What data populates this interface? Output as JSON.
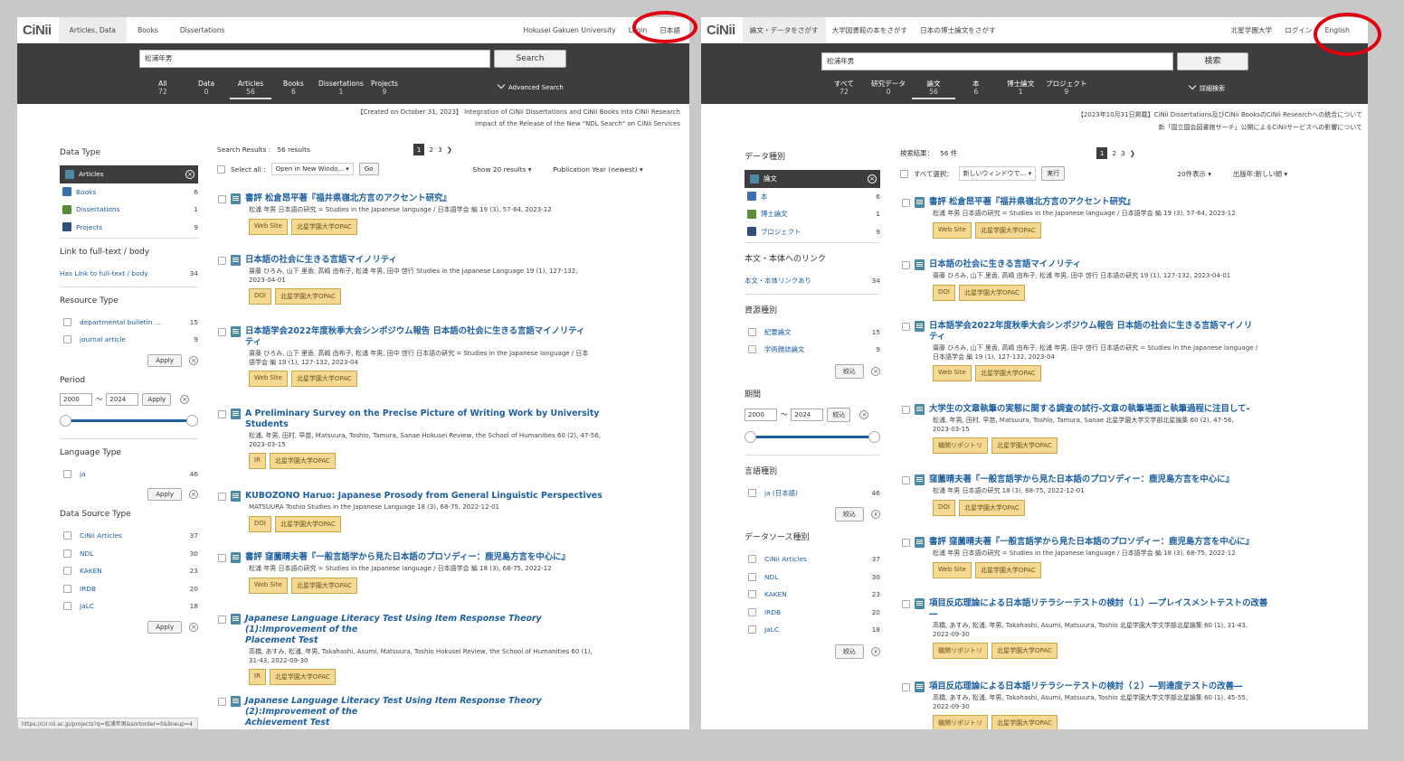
{
  "en": {
    "logo": "CiNii",
    "nav": [
      "Articles, Data",
      "Books",
      "Dissertations"
    ],
    "univ": "Hokusei Gakuen University",
    "login": "Login",
    "lang": "日本語",
    "query": "松浦年男",
    "search_btn": "Search",
    "tabs": [
      {
        "l": "All",
        "n": "72"
      },
      {
        "l": "Data",
        "n": "0"
      },
      {
        "l": "Articles",
        "n": "56"
      },
      {
        "l": "Books",
        "n": "6"
      },
      {
        "l": "Dissertations",
        "n": "1"
      },
      {
        "l": "Projects",
        "n": "9"
      }
    ],
    "adv": "Advanced Search",
    "ann1": "【Created on October 31, 2023】 Integration of CiNii Dissertations and CiNii Books into CiNii Research",
    "ann2": "Impact of the Release of the New \"NDL Search\" on CiNii Services",
    "f_datatype": "Data Type",
    "types": [
      {
        "l": "Articles",
        "c": ""
      },
      {
        "l": "Books",
        "c": "6"
      },
      {
        "l": "Dissertations",
        "c": "1"
      },
      {
        "l": "Projects",
        "c": "9"
      }
    ],
    "f_link": "Link to full-text / body",
    "link_item": "Has Link to full-text / body",
    "link_count": "34",
    "f_resource": "Resource Type",
    "resources": [
      {
        "l": "departmental bulletin ...",
        "c": "15"
      },
      {
        "l": "journal article",
        "c": "9"
      }
    ],
    "apply": "Apply",
    "f_period": "Period",
    "from": "2000",
    "to": "2024",
    "tilde": "〜",
    "f_lang": "Language Type",
    "langs": [
      {
        "l": "ja",
        "c": "46"
      }
    ],
    "f_source": "Data Source Type",
    "sources": [
      {
        "l": "CiNii Articles",
        "c": "37"
      },
      {
        "l": "NDL",
        "c": "30"
      },
      {
        "l": "KAKEN",
        "c": "23"
      },
      {
        "l": "IRDB",
        "c": "20"
      },
      {
        "l": "JaLC",
        "c": "18"
      }
    ],
    "results_label": "Search Results :",
    "results_count": "56 results",
    "pages": [
      "1",
      "2",
      "3"
    ],
    "selectall": "Select all :",
    "open": "Open in New Windo...",
    "go": "Go",
    "show": "Show 20 results",
    "sort": "Publication Year (newest)",
    "results": [
      {
        "t": "書評 松倉昂平著『福井県嶺北方言のアクセント研究』",
        "m": [
          "松浦 年男 日本語の研究 = Studies in the Japanese language / 日本語学会 編 19 (3), 57-64, 2023-12"
        ],
        "b": [
          "Web Site",
          "北星学園大学OPAC"
        ]
      },
      {
        "t": "日本語の社会に生きる言語マイノリティ",
        "m": [
          "齋藤 ひろみ, 山下 里香, 高嶋 由布子, 松浦 年男, 田中 啓行 Studies in the Japanese Language 19 (1), 127-132,",
          "2023-04-01"
        ],
        "b": [
          "DOI",
          "北星学園大学OPAC"
        ]
      },
      {
        "t": "日本語学会2022年度秋季大会シンポジウム報告 日本語の社会に生きる言語マイノリティ",
        "t2": "ティ",
        "m": [
          "齋藤 ひろみ, 山下 里香, 高嶋 由布子, 松浦 年男, 田中 啓行 日本語の研究 = Studies in the Japanese language / 日本",
          "語学会 編 19 (1), 127-132, 2023-04"
        ],
        "b": [
          "Web Site",
          "北星学園大学OPAC"
        ]
      },
      {
        "t": "A Preliminary Survey on the Precise Picture of Writing Work by University",
        "t2": "Students",
        "m": [
          "松浦, 年男, 田村, 早苗, Matsuura, Toshio, Tamura, Sanae Hokusei Review, the School of Humanities 60 (2), 47-56,",
          "2023-03-15"
        ],
        "b": [
          "IR",
          "北星学園大学OPAC"
        ]
      },
      {
        "t": "KUBOZONO Haruo: Japanese Prosody from General Linguistic Perspectives",
        "m": [
          "MATSUURA Toshio Studies in the Japanese Language 18 (3), 68-75, 2022-12-01"
        ],
        "b": [
          "DOI",
          "北星学園大学OPAC"
        ]
      },
      {
        "t": "書評 窪薗晴夫著『一般言語学から見た日本語のプロソディー：鹿児島方言を中心に』",
        "m": [
          "松浦 年男 日本語の研究 = Studies in the Japanese language / 日本語学会 編 18 (3), 68-75, 2022-12"
        ],
        "b": [
          "Web Site",
          "北星学園大学OPAC"
        ]
      },
      {
        "t": "Japanese Language Literacy Test Using Item Response Theory (1):Improvement of the",
        "t2": "Placement Test",
        "it": true,
        "m": [
          "高橋, あすみ, 松浦, 年男, Takahashi, Asumi, Matsuura, Toshio Hokusei Review, the School of Humanities 60 (1),",
          "31-43, 2022-09-30"
        ],
        "b": [
          "IR",
          "北星学園大学OPAC"
        ]
      },
      {
        "t": "Japanese Language Literacy Test Using Item Response Theory (2):Improvement of the",
        "t2": "Achievement Test",
        "it": true,
        "m": [],
        "b": []
      }
    ],
    "url": "https://cir.nii.ac.jp/projects?q=松浦年男&sortorder=0&lineup=4"
  },
  "ja": {
    "logo": "CiNii",
    "nav": [
      "論文・データをさがす",
      "大学図書館の本をさがす",
      "日本の博士論文をさがす"
    ],
    "univ": "北星学園大学",
    "login": "ログイン",
    "lang": "English",
    "query": "松浦年男",
    "search_btn": "検索",
    "tabs": [
      {
        "l": "すべて",
        "n": "72"
      },
      {
        "l": "研究データ",
        "n": "0"
      },
      {
        "l": "論文",
        "n": "56"
      },
      {
        "l": "本",
        "n": "6"
      },
      {
        "l": "博士論文",
        "n": "1"
      },
      {
        "l": "プロジェクト",
        "n": "9"
      }
    ],
    "adv": "詳細検索",
    "ann1": "【2023年10月31日掲載】CiNii Dissertations及びCiNii BooksのCiNii Researchへの統合について",
    "ann2": "新「国立国会図書館サーチ」公開によるCiNiiサービスへの影響について",
    "f_datatype": "データ種別",
    "types": [
      {
        "l": "論文",
        "c": ""
      },
      {
        "l": "本",
        "c": "6"
      },
      {
        "l": "博士論文",
        "c": "1"
      },
      {
        "l": "プロジェクト",
        "c": "9"
      }
    ],
    "f_link": "本文・本体へのリンク",
    "link_item": "本文・本体リンクあり",
    "link_count": "34",
    "f_resource": "資源種別",
    "resources": [
      {
        "l": "紀要論文",
        "c": "15"
      },
      {
        "l": "学術雑誌論文",
        "c": "9"
      }
    ],
    "apply": "絞込",
    "f_period": "期間",
    "from": "2000",
    "to": "2024",
    "tilde": "〜",
    "f_lang": "言語種別",
    "langs": [
      {
        "l": "ja (日本語)",
        "c": "46"
      }
    ],
    "f_source": "データソース種別",
    "sources": [
      {
        "l": "CiNii Articles",
        "c": "37"
      },
      {
        "l": "NDL",
        "c": "30"
      },
      {
        "l": "KAKEN",
        "c": "23"
      },
      {
        "l": "IRDB",
        "c": "20"
      },
      {
        "l": "JaLC",
        "c": "18"
      }
    ],
    "results_label": "検索結果：",
    "results_count": "56 件",
    "pages": [
      "1",
      "2",
      "3"
    ],
    "selectall": "すべて選択：",
    "open": "新しいウィンドウで…",
    "go": "実行",
    "show": "20件表示",
    "sort": "出版年:新しい順",
    "results": [
      {
        "t": "書評 松倉昂平著『福井県嶺北方言のアクセント研究』",
        "m": [
          "松浦 年男 日本語の研究 = Studies in the Japanese language / 日本語学会 編 19 (3), 57-64, 2023-12"
        ],
        "b": [
          "Web Site",
          "北星学園大学OPAC"
        ]
      },
      {
        "t": "日本語の社会に生きる言語マイノリティ",
        "m": [
          "齋藤 ひろみ, 山下 里香, 高嶋 由布子, 松浦 年男, 田中 啓行 日本語の研究 19 (1), 127-132, 2023-04-01"
        ],
        "b": [
          "DOI",
          "北星学園大学OPAC"
        ]
      },
      {
        "t": "日本語学会2022年度秋季大会シンポジウム報告 日本語の社会に生きる言語マイノリ",
        "t2": "ティ",
        "m": [
          "齋藤 ひろみ, 山下 里香, 高嶋 由布子, 松浦 年男, 田中 啓行 日本語の研究 = Studies in the Japanese language /",
          "日本語学会 編 19 (1), 127-132, 2023-04"
        ],
        "b": [
          "Web Site",
          "北星学園大学OPAC"
        ]
      },
      {
        "t": "大学生の文章執筆の実態に関する調査の試行-文章の執筆場面と執筆過程に注目して-",
        "m": [
          "松浦, 年男, 田村, 早苗, Matsuura, Toshio, Tamura, Sanae 北星学園大学文学部北星論集 60 (2), 47-56,",
          "2023-03-15"
        ],
        "b": [
          "機関リポジトリ",
          "北星学園大学OPAC"
        ]
      },
      {
        "t": "窪薗晴夫著『一般言語学から見た日本語のプロソディー：鹿児島方言を中心に』",
        "m": [
          "松浦 年男 日本語の研究 18 (3), 68-75, 2022-12-01"
        ],
        "b": [
          "DOI",
          "北星学園大学OPAC"
        ]
      },
      {
        "t": "書評 窪薗晴夫著『一般言語学から見た日本語のプロソディー：鹿児島方言を中心に』",
        "m": [
          "松浦 年男 日本語の研究 = Studies in the Japanese language / 日本語学会 編 18 (3), 68-75, 2022-12"
        ],
        "b": [
          "Web Site",
          "北星学園大学OPAC"
        ]
      },
      {
        "t": "項目反応理論による日本語リテラシーテストの検討（１）―プレイスメントテストの改善",
        "t2": "―",
        "m": [
          "高橋, あすみ, 松浦, 年男, Takahashi, Asumi, Matsuura, Toshio 北星学園大学文学部北星論集 60 (1), 31-43,",
          "2022-09-30"
        ],
        "b": [
          "機関リポジトリ",
          "北星学園大学OPAC"
        ]
      },
      {
        "t": "項目反応理論による日本語リテラシーテストの検討（２）―到達度テストの改善―",
        "m": [
          "高橋, あすみ, 松浦, 年男, Takahashi, Asumi, Matsuura, Toshio 北星学園大学文学部北星論集 60 (1), 45-55,",
          "2022-09-30"
        ],
        "b": [
          "機関リポジトリ",
          "北星学園大学OPAC"
        ]
      }
    ]
  }
}
